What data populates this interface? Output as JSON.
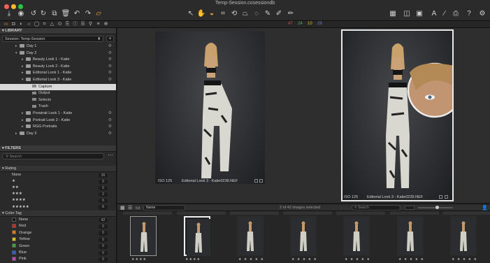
{
  "window": {
    "title": "Temp-Session.cosessiondb"
  },
  "tabs_counts": {
    "red": "47",
    "green": "24",
    "yellow": "10",
    "blue": "29"
  },
  "library": {
    "header": "LIBRARY",
    "session": "Session: Temp-Session",
    "folders": [
      {
        "label": "Day 1",
        "level": 1,
        "open": false
      },
      {
        "label": "Day 2",
        "level": 1,
        "open": true
      },
      {
        "label": "Beauty Look 1 - Katie",
        "level": 2,
        "open": false
      },
      {
        "label": "Beauty Look 2 - Katie",
        "level": 2,
        "open": false
      },
      {
        "label": "Editorial Look 1 - Katie",
        "level": 2,
        "open": false
      },
      {
        "label": "Editorial Look 3 - Katie",
        "level": 2,
        "open": true
      },
      {
        "label": "Capture",
        "level": 3,
        "open": false,
        "selected": true
      },
      {
        "label": "Output",
        "level": 3,
        "open": false
      },
      {
        "label": "Selects",
        "level": 3,
        "open": false
      },
      {
        "label": "Trash",
        "level": 3,
        "open": false
      },
      {
        "label": "Poratrait Look 1 - Katie",
        "level": 2,
        "open": false
      },
      {
        "label": "Portrait Look 2 - Katie",
        "level": 2,
        "open": false
      },
      {
        "label": "RGG Portraits",
        "level": 2,
        "open": false
      },
      {
        "label": "Day 3",
        "level": 1,
        "open": false
      }
    ]
  },
  "filters": {
    "header": "FILTERS",
    "search_placeholder": "Search",
    "rating_header": "Rating",
    "ratings": [
      {
        "label": "None",
        "count": "26"
      },
      {
        "label": "★",
        "count": "0"
      },
      {
        "label": "★★",
        "count": "0"
      },
      {
        "label": "★★★",
        "count": "2"
      },
      {
        "label": "★★★★",
        "count": "6"
      },
      {
        "label": "★★★★★",
        "count": "8"
      }
    ],
    "color_tag_header": "Color Tag",
    "color_tags": [
      {
        "label": "None",
        "count": "42",
        "color": "#1a1a1a"
      },
      {
        "label": "Red",
        "count": "0",
        "color": "#c62d22"
      },
      {
        "label": "Orange",
        "count": "0",
        "color": "#de7a17"
      },
      {
        "label": "Yellow",
        "count": "0",
        "color": "#d8c117"
      },
      {
        "label": "Green",
        "count": "0",
        "color": "#3aa43a"
      },
      {
        "label": "Blue",
        "count": "0",
        "color": "#2c5fcf"
      },
      {
        "label": "Pink",
        "count": "0",
        "color": "#c745b6"
      }
    ]
  },
  "viewer": {
    "left": {
      "iso": "ISO 125",
      "filename": "Editorial Look 3 - Katie0238.NEF"
    },
    "right": {
      "iso": "ISO 125",
      "filename": "Editorial Look 3 - Katie0239.NEF"
    }
  },
  "browser": {
    "sort_label": "Name",
    "status": "2 of 42 images selected",
    "search_placeholder": "Search"
  },
  "thumbnails": [
    {
      "stars": "★★★★",
      "selected": "light"
    },
    {
      "stars": "★★★★",
      "selected": "bright"
    },
    {
      "stars": "★ ★ ★ ★ ★",
      "selected": "none"
    },
    {
      "stars": "★ ★ ★ ★ ★",
      "selected": "none"
    },
    {
      "stars": "★ ★ ★ ★ ★",
      "selected": "none"
    },
    {
      "stars": "★ ★ ★ ★ ★",
      "selected": "none"
    },
    {
      "stars": "★ ★ ★ ★ ★",
      "selected": "none"
    }
  ],
  "icons": {
    "accent": "#e8a33b"
  }
}
